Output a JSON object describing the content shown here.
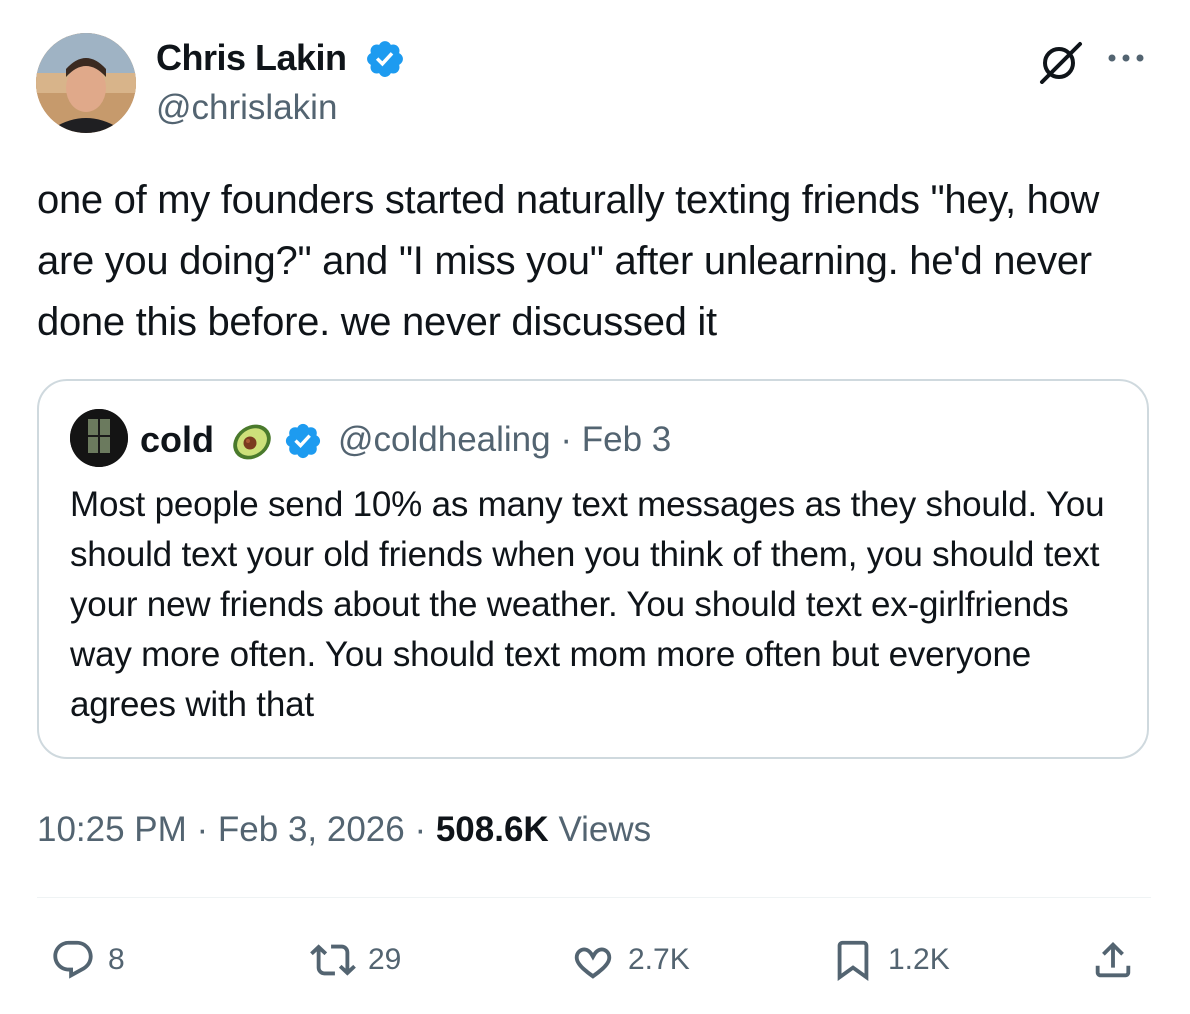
{
  "author": {
    "name": "Chris Lakin",
    "handle": "@chrislakin",
    "verified": true
  },
  "tweet": {
    "text": "one of my founders started naturally texting friends \"hey, how are you doing?\" and \"I miss you\" after unlearning. he'd never done this before. we never discussed it"
  },
  "quote": {
    "name": "cold",
    "emoji_icon": "avocado-icon",
    "verified": true,
    "handle": "@coldhealing",
    "separator": "·",
    "date": "Feb 3",
    "text": "Most people send 10% as many text messages as they should. You should text your old friends when you think of them, you should text your new friends about the weather. You should text ex-girlfriends way more often. You should text mom more often but everyone agrees with that"
  },
  "meta": {
    "time": "10:25 PM",
    "sep1": " · ",
    "date": "Feb 3, 2026",
    "sep2": " · ",
    "views_count": "508.6K",
    "views_label": " Views"
  },
  "actions": {
    "replies": "8",
    "reposts": "29",
    "likes": "2.7K",
    "bookmarks": "1.2K"
  },
  "colors": {
    "text_primary": "#0f1419",
    "text_secondary": "#536471",
    "verified_blue": "#1d9bf0",
    "border": "#cfd9de"
  },
  "icons": [
    "grok-icon",
    "more-icon",
    "verified-badge-icon",
    "reply-icon",
    "repost-icon",
    "like-icon",
    "bookmark-icon",
    "share-icon"
  ]
}
